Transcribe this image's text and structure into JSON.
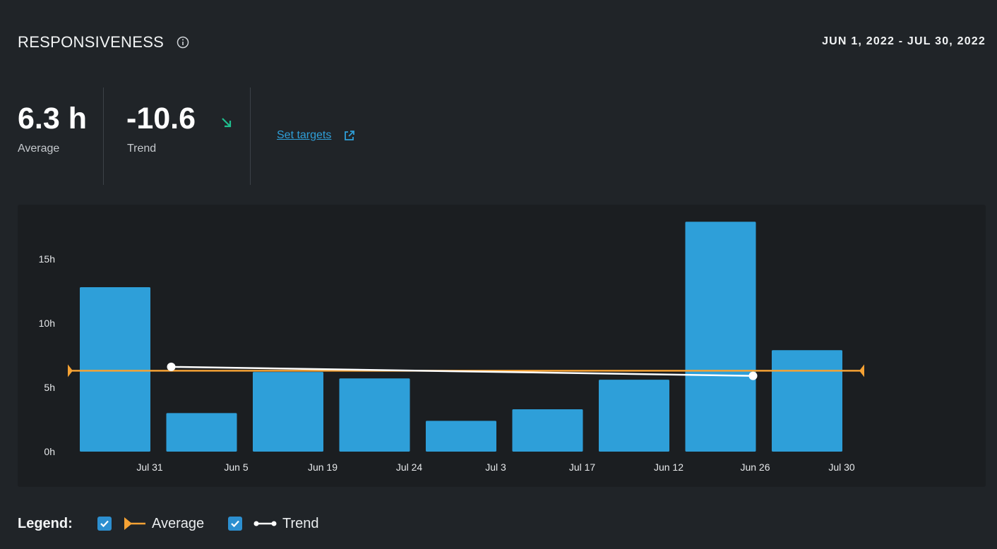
{
  "header": {
    "title": "RESPONSIVENESS",
    "date_range": "JUN 1, 2022 - JUL 30, 2022"
  },
  "stats": {
    "average": {
      "value": "6.3 h",
      "label": "Average"
    },
    "trend": {
      "value": "-10.6",
      "label": "Trend"
    }
  },
  "actions": {
    "set_targets": "Set targets"
  },
  "legend": {
    "title": "Legend:",
    "items": [
      {
        "label": "Average",
        "checked": true
      },
      {
        "label": "Trend",
        "checked": true
      }
    ]
  },
  "colors": {
    "bar": "#2e9fd9",
    "average": "#f5a234",
    "trend": "#ffffff",
    "trend_down": "#1fbf8f",
    "link": "#2f9fd8"
  },
  "chart_data": {
    "type": "bar",
    "categories": [
      "Jul 31",
      "Jun 5",
      "Jun 19",
      "Jul 24",
      "Jul 3",
      "Jul 17",
      "Jun 12",
      "Jun 26",
      "Jul 30"
    ],
    "values": [
      12.8,
      3.0,
      6.2,
      5.7,
      2.4,
      3.3,
      5.6,
      17.9,
      7.9
    ],
    "ylim": [
      0,
      18.5
    ],
    "yticks": [
      0,
      5,
      10,
      15
    ],
    "ytick_labels": [
      "0h",
      "5h",
      "10h",
      "15h"
    ],
    "average": 6.3,
    "trend": {
      "start": 6.6,
      "end": 5.9
    },
    "series": [
      {
        "name": "Average"
      },
      {
        "name": "Trend"
      }
    ]
  }
}
